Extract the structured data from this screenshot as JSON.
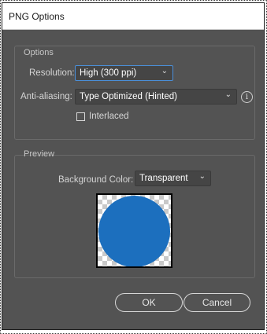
{
  "dialog": {
    "title": "PNG Options"
  },
  "options": {
    "group_label": "Options",
    "resolution": {
      "label": "Resolution:",
      "value": "High (300 ppi)"
    },
    "anti_aliasing": {
      "label": "Anti-aliasing:",
      "value": "Type Optimized (Hinted)"
    },
    "interlaced": {
      "label": "Interlaced",
      "checked": false
    }
  },
  "preview": {
    "group_label": "Preview",
    "background_color": {
      "label": "Background Color:",
      "value": "Transparent"
    },
    "swatch_color": "#1c6fbe"
  },
  "buttons": {
    "ok": "OK",
    "cancel": "Cancel"
  },
  "icons": {
    "dropdown": "chevron-down-icon",
    "info": "info-icon"
  }
}
